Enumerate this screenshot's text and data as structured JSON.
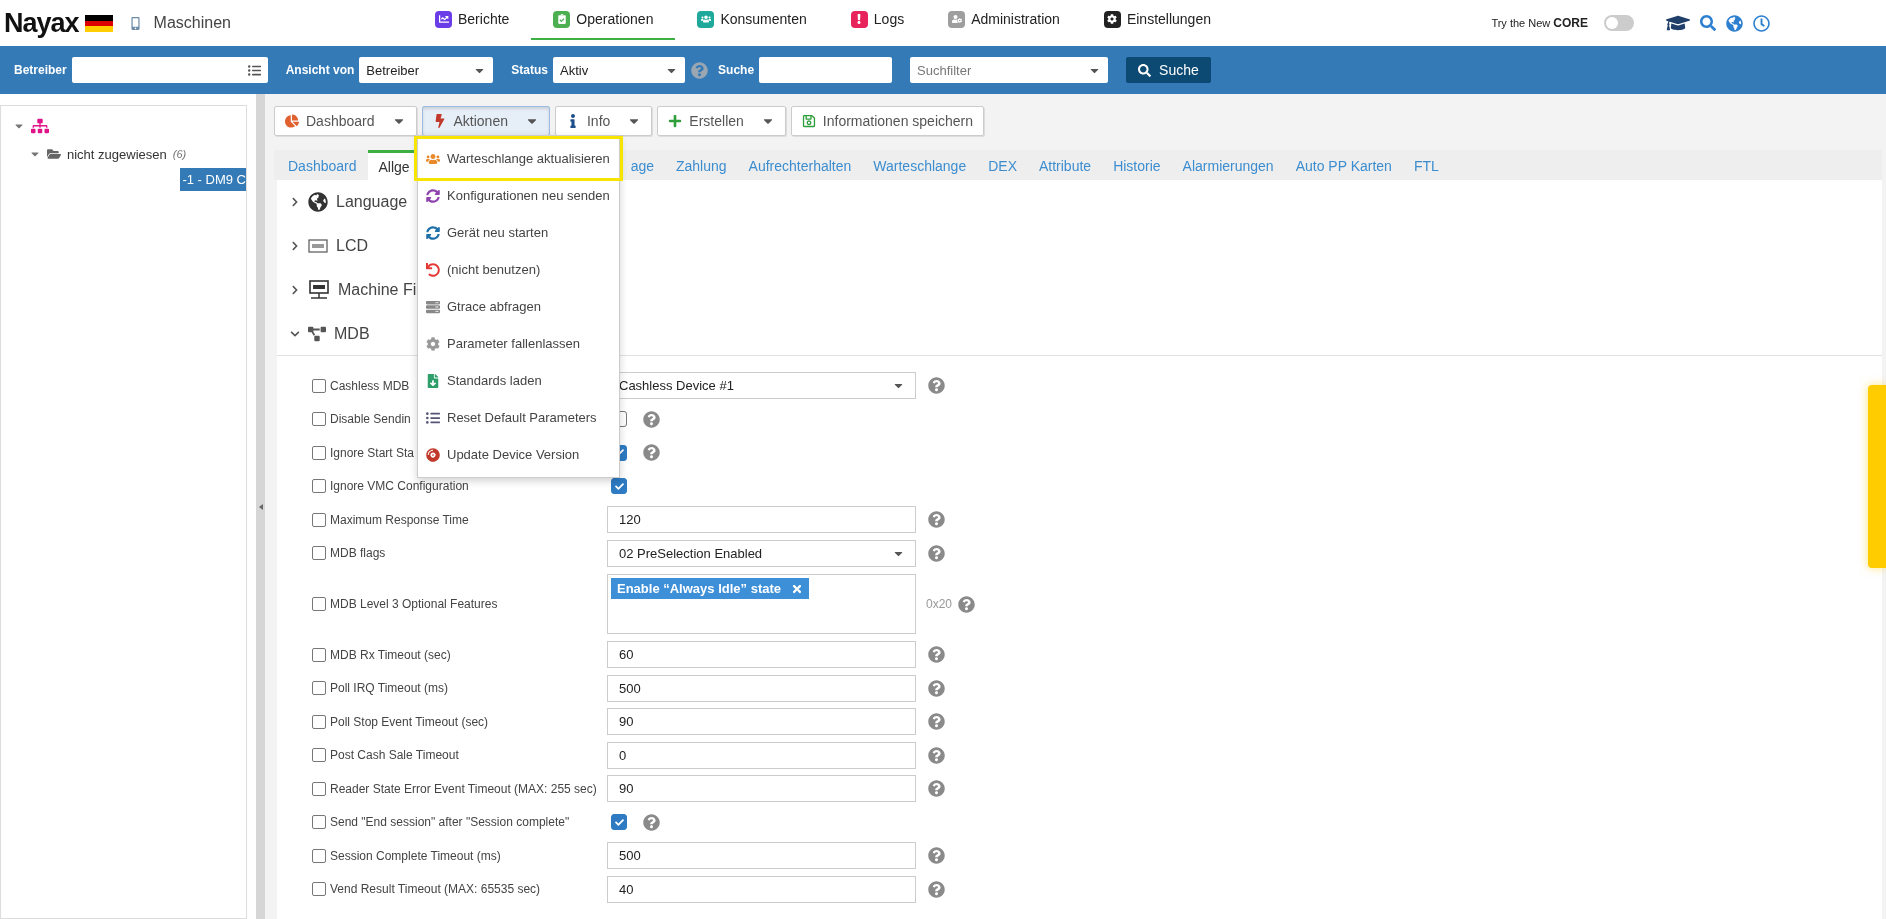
{
  "top_nav": {
    "logo": "Nayax",
    "section": "Maschinen",
    "items": [
      {
        "label": "Berichte",
        "selected": false,
        "color": "#6a3de8"
      },
      {
        "label": "Operationen",
        "selected": true,
        "color": "#4caf50"
      },
      {
        "label": "Konsumenten",
        "selected": false,
        "color": "#1fa99a"
      },
      {
        "label": "Logs",
        "selected": false,
        "color": "#e8225a"
      },
      {
        "label": "Administration",
        "selected": false,
        "color": "#9e9e9e"
      },
      {
        "label": "Einstellungen",
        "selected": false,
        "color": "#222222"
      }
    ],
    "core_promo": "Try the New **CORE**",
    "core_toggle": {
      "on": false
    }
  },
  "filter_bar": {
    "fields": [
      {
        "label": "Betreiber",
        "kind": "lookup"
      },
      {
        "label": "Ansicht von",
        "kind": "select",
        "value": "Betreiber"
      },
      {
        "label": "Status",
        "kind": "select",
        "value": "Aktiv",
        "help": true
      },
      {
        "label": "Suche",
        "kind": "text"
      },
      {
        "kind": "select",
        "placeholder": "Suchfilter"
      }
    ],
    "button": "Suche"
  },
  "tree": [
    {
      "expanded": true,
      "children": [
        {
          "label": "nicht zugewiesen",
          "count": "(6)",
          "expanded": true,
          "children": [
            {
              "label": "-1 - DM9 C",
              "selected": true
            }
          ]
        }
      ]
    }
  ],
  "toolbar": [
    {
      "label": "Dashboard",
      "caret": true,
      "expanded": false
    },
    {
      "label": "Aktionen",
      "caret": true,
      "expanded": true
    },
    {
      "label": "Info",
      "caret": true,
      "expanded": false
    },
    {
      "label": "Erstellen",
      "caret": true,
      "expanded": false
    },
    {
      "label": "Informationen speichern",
      "caret": false,
      "expanded": false
    }
  ],
  "actions_menu": [
    {
      "label": "Warteschlange aktualisieren",
      "highlighted": true
    },
    {
      "label": "Konfigurationen neu senden",
      "highlighted": false
    },
    {
      "label": "Gerät neu starten",
      "highlighted": false
    },
    {
      "label": "(nicht benutzen)",
      "highlighted": false
    },
    {
      "label": "Gtrace abfragen",
      "highlighted": false
    },
    {
      "label": "Parameter fallenlassen",
      "highlighted": false
    },
    {
      "label": "Standards laden",
      "highlighted": false
    },
    {
      "label": "Reset Default Parameters",
      "highlighted": false
    },
    {
      "label": "Update Device Version",
      "highlighted": false
    }
  ],
  "tabs": [
    {
      "label": "Dashboard",
      "selected": false
    },
    {
      "label": "Allge",
      "selected": true
    },
    {
      "label": "age",
      "selected": false
    },
    {
      "label": "Zahlung",
      "selected": false
    },
    {
      "label": "Aufrechterhalten",
      "selected": false
    },
    {
      "label": "Warteschlange",
      "selected": false
    },
    {
      "label": "DEX",
      "selected": false
    },
    {
      "label": "Attribute",
      "selected": false
    },
    {
      "label": "Historie",
      "selected": false
    },
    {
      "label": "Alarmierungen",
      "selected": false
    },
    {
      "label": "Auto PP Karten",
      "selected": false
    },
    {
      "label": "FTL",
      "selected": false
    }
  ],
  "sections": [
    {
      "title": "Language",
      "expanded": false
    },
    {
      "title": "LCD",
      "expanded": false
    },
    {
      "title": "Machine Fi",
      "expanded": false
    },
    {
      "title": "MDB",
      "expanded": true
    }
  ],
  "settings": [
    {
      "label": "Cashless MDB",
      "checked": false,
      "kind": "select",
      "value": "Cashless Device #1",
      "help": true
    },
    {
      "label": "Disable Sendin",
      "checked": false,
      "kind": "checkbox",
      "on": false,
      "help": true
    },
    {
      "label": "Ignore Start Sta",
      "checked": false,
      "kind": "checkbox",
      "on": true,
      "help": true
    },
    {
      "label": "Ignore VMC Configuration",
      "checked": false,
      "kind": "checkbox",
      "on": true,
      "help": false
    },
    {
      "label": "Maximum Response Time",
      "checked": false,
      "kind": "text",
      "value": "120",
      "help": true
    },
    {
      "label": "MDB flags",
      "checked": false,
      "kind": "select",
      "value": "02 PreSelection Enabled",
      "help": true
    },
    {
      "label": "MDB Level 3 Optional Features",
      "checked": false,
      "kind": "tags",
      "tags": [
        "Enable “Always Idle” state"
      ],
      "note": "0x20",
      "help": true
    },
    {
      "label": "MDB Rx Timeout (sec)",
      "checked": false,
      "kind": "text",
      "value": "60",
      "help": true
    },
    {
      "label": "Poll IRQ Timeout (ms)",
      "checked": false,
      "kind": "text",
      "value": "500",
      "help": true
    },
    {
      "label": "Poll Stop Event Timeout (sec)",
      "checked": false,
      "kind": "text",
      "value": "90",
      "help": true
    },
    {
      "label": "Post Cash Sale Timeout",
      "checked": false,
      "kind": "text",
      "value": "0",
      "help": true
    },
    {
      "label": "Reader State Error Event Timeout (MAX: 255 sec)",
      "checked": false,
      "kind": "text",
      "value": "90",
      "help": true
    },
    {
      "label": "Send \"End session\" after \"Session complete\"",
      "checked": false,
      "kind": "checkbox",
      "on": true,
      "help": true
    },
    {
      "label": "Session Complete Timeout (ms)",
      "checked": false,
      "kind": "text",
      "value": "500",
      "help": true
    },
    {
      "label": "Vend Result Timeout (MAX: 65535 sec)",
      "checked": false,
      "kind": "text",
      "value": "40",
      "help": true
    }
  ]
}
